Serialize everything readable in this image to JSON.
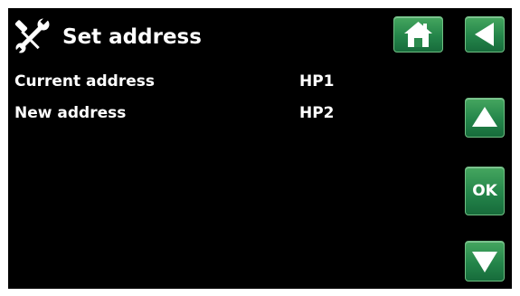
{
  "header": {
    "title": "Set address",
    "icon": "tools-icon"
  },
  "rows": [
    {
      "label": "Current address",
      "value": "HP1"
    },
    {
      "label": "New address",
      "value": "HP2"
    }
  ],
  "buttons": {
    "home": {
      "icon": "home-icon"
    },
    "back": {
      "icon": "back-arrow-icon"
    },
    "up": {
      "icon": "up-arrow-icon"
    },
    "ok": {
      "label": "OK"
    },
    "down": {
      "icon": "down-arrow-icon"
    }
  },
  "colors": {
    "background": "#000000",
    "text": "#ffffff",
    "button": "#24854a",
    "button_border": "#6fbf83"
  }
}
